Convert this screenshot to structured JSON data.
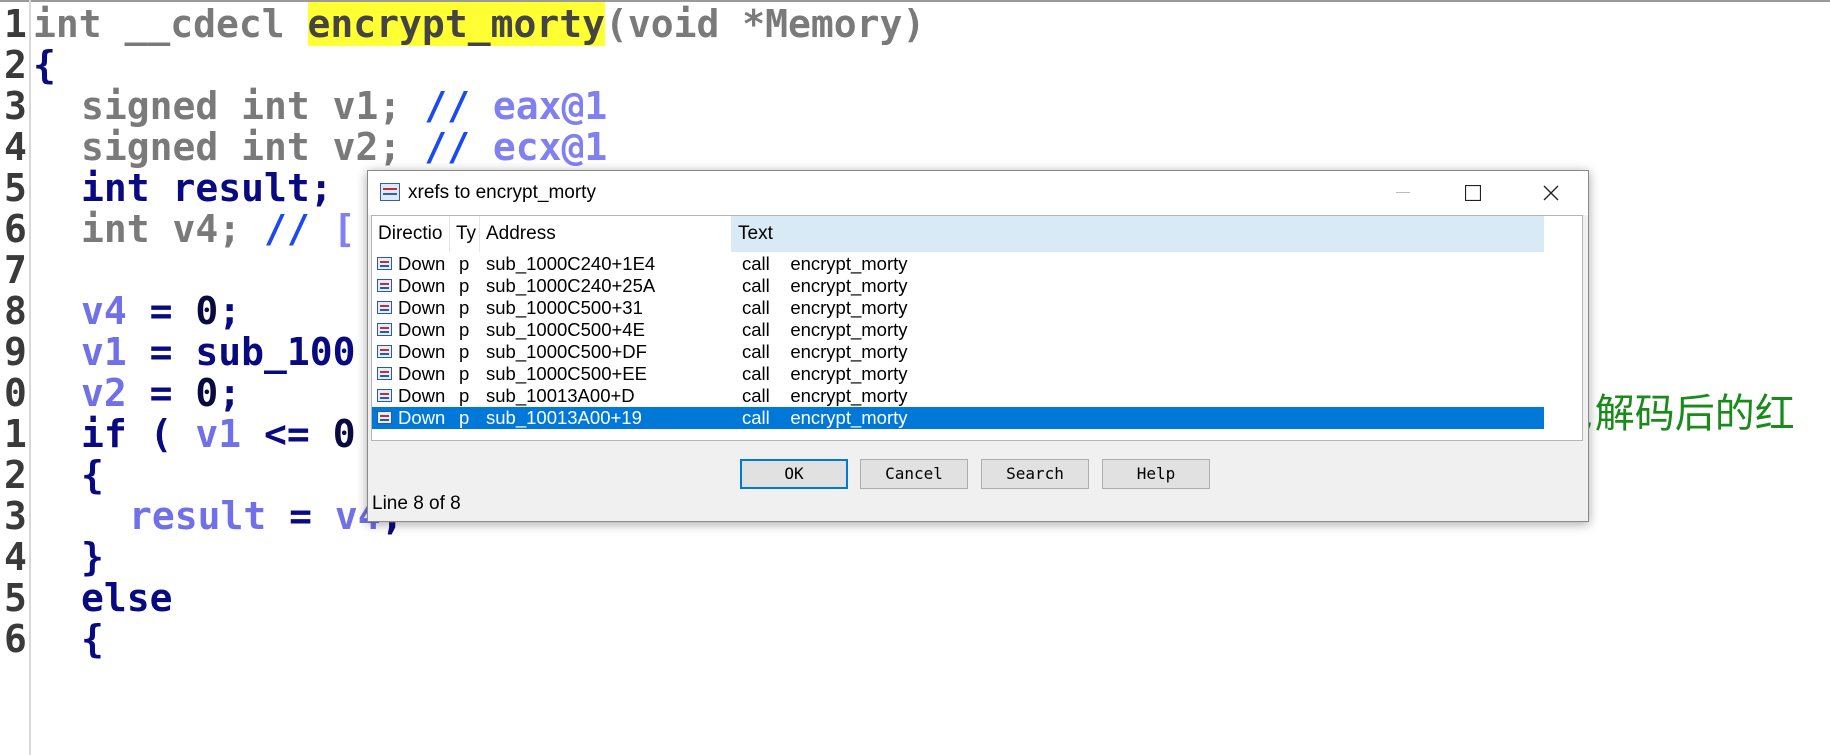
{
  "code": {
    "line_numbers": [
      "1",
      "2",
      "3",
      "4",
      "5",
      "6",
      "7",
      "8",
      "9",
      "0",
      "1",
      "2",
      "3",
      "4",
      "5",
      "6"
    ],
    "line1": {
      "kw": "int __cdecl ",
      "func": "encrypt_morty",
      "rest": "(void *Memory)"
    },
    "line2": "{",
    "line3": {
      "kw": "signed int ",
      "var": "v1",
      "semi": ";",
      "cmt": " // ",
      "reg": "eax@1"
    },
    "line4": {
      "kw": "signed int ",
      "var": "v2",
      "semi": ";",
      "cmt": " // ",
      "reg": "ecx@1"
    },
    "line5": {
      "kw": "int ",
      "var": "result",
      "semi": ";"
    },
    "line6": {
      "kw": "int ",
      "var": "v4",
      "semi": ";",
      "cmt": " // ",
      "tail": "["
    },
    "line8": {
      "var": "v4",
      "op": " = ",
      "num": "0",
      "semi": ";"
    },
    "line9": {
      "var": "v1",
      "op": " = ",
      "call": "sub_100"
    },
    "line10": {
      "var": "v2",
      "op": " = ",
      "num": "0",
      "semi": ";"
    },
    "line11": {
      "kw": "if",
      "open": " ( ",
      "var": "v1",
      "op": " <= ",
      "num": "0"
    },
    "line12": "{",
    "line13": {
      "var": "result",
      "op": " = ",
      "var2": "v4",
      "semi": ";"
    },
    "line14": "}",
    "line15": "else",
    "line16": "{",
    "green_comment": ",解码后的红"
  },
  "dialog": {
    "title": "xrefs to encrypt_morty",
    "columns": {
      "direction": "Directio",
      "type": "Ty",
      "address": "Address",
      "text": "Text"
    },
    "rows": [
      {
        "dir": "Down",
        "ty": "p",
        "addr": "sub_1000C240+1E4",
        "text": "call    encrypt_morty"
      },
      {
        "dir": "Down",
        "ty": "p",
        "addr": "sub_1000C240+25A",
        "text": "call    encrypt_morty"
      },
      {
        "dir": "Down",
        "ty": "p",
        "addr": "sub_1000C500+31",
        "text": "call    encrypt_morty"
      },
      {
        "dir": "Down",
        "ty": "p",
        "addr": "sub_1000C500+4E",
        "text": "call    encrypt_morty"
      },
      {
        "dir": "Down",
        "ty": "p",
        "addr": "sub_1000C500+DF",
        "text": "call    encrypt_morty"
      },
      {
        "dir": "Down",
        "ty": "p",
        "addr": "sub_1000C500+EE",
        "text": "call    encrypt_morty"
      },
      {
        "dir": "Down",
        "ty": "p",
        "addr": "sub_10013A00+D",
        "text": "call    encrypt_morty"
      },
      {
        "dir": "Down",
        "ty": "p",
        "addr": "sub_10013A00+19",
        "text": "call    encrypt_morty"
      }
    ],
    "selected_row": 8,
    "buttons": {
      "ok": "OK",
      "cancel": "Cancel",
      "search": "Search",
      "help": "Help"
    },
    "status": "Line 8 of 8"
  },
  "colors": {
    "selection": "#0078d7",
    "highlight": "#ffff33",
    "header_text_col": "#d9eaf7"
  }
}
